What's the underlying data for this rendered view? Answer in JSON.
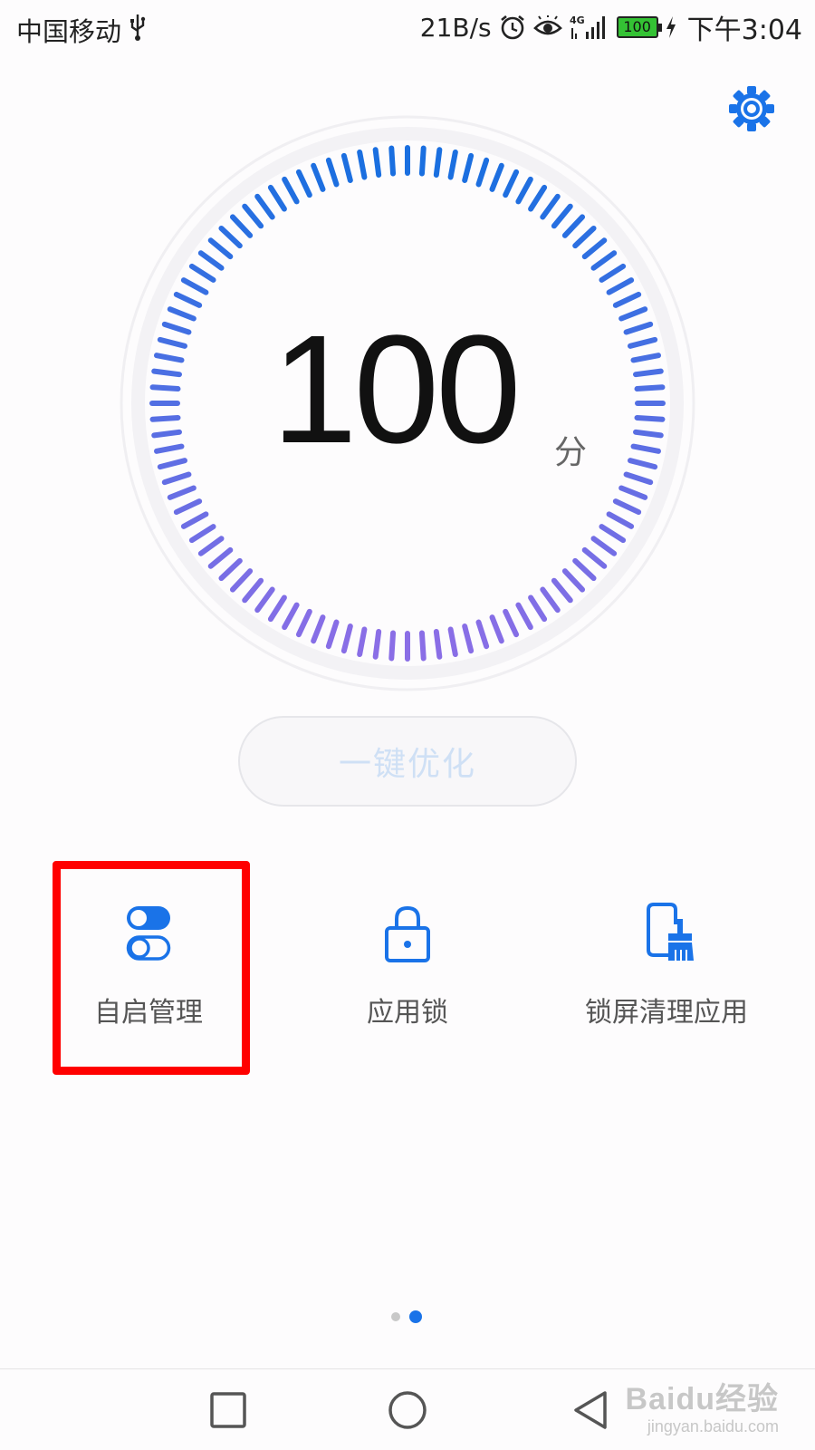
{
  "status_bar": {
    "carrier": "中国移动",
    "net_speed": "21B/s",
    "network": "4G",
    "battery": "100",
    "time": "下午3:04"
  },
  "score": {
    "value": "100",
    "unit": "分"
  },
  "optimize_button": {
    "label": "一键优化"
  },
  "features": [
    {
      "label": "自启管理",
      "icon": "toggle-switches-icon"
    },
    {
      "label": "应用锁",
      "icon": "padlock-icon"
    },
    {
      "label": "锁屏清理应用",
      "icon": "phone-broom-icon"
    }
  ],
  "pager": {
    "total": 2,
    "active": 2
  },
  "watermark": {
    "main": "Baidu经验",
    "sub": "jingyan.baidu.com"
  },
  "colors": {
    "accent": "#1a73e8",
    "highlight": "#ff0000",
    "gauge_start": "#1a6fe0",
    "gauge_end": "#8a6ee6"
  }
}
